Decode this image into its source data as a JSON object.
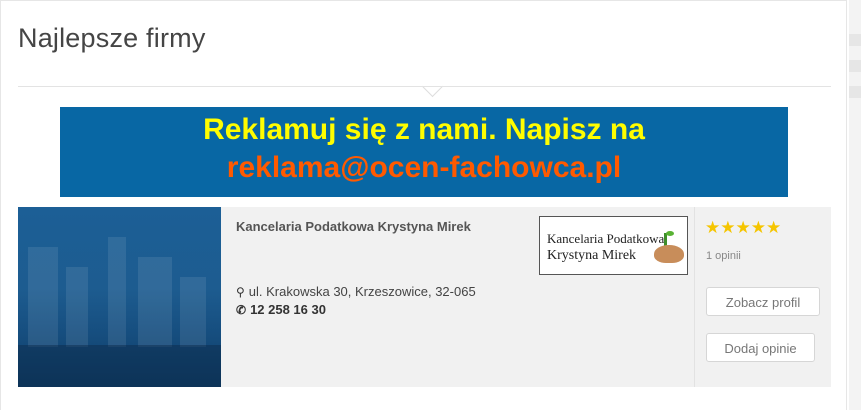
{
  "section": {
    "title": "Najlepsze firmy"
  },
  "banner": {
    "line1": "Reklamuj się z nami. Napisz na",
    "line2": "reklama@ocen-fachowca.pl",
    "bg_color": "#0867a4",
    "line1_color": "#fffd00",
    "line2_color": "#ff5a00"
  },
  "listing": {
    "company_name": "Kancelaria Podatkowa Krystyna Mirek",
    "address": "ul. Krakowska 30, Krzeszowice, 32-065",
    "phone": "12 258 16 30",
    "address_icon": "map-pin-icon",
    "phone_icon": "phone-icon",
    "logo": {
      "line1": "Kancelaria Podatkowa",
      "line2": "Krystyna Mirek"
    },
    "rating": {
      "stars": "★★★★★",
      "value": 5,
      "max": 5,
      "reviews_label": "1 opinii",
      "star_color": "#f5c500"
    },
    "view_profile_label": "Zobacz profil",
    "add_opinion_label": "Dodaj opinie"
  }
}
